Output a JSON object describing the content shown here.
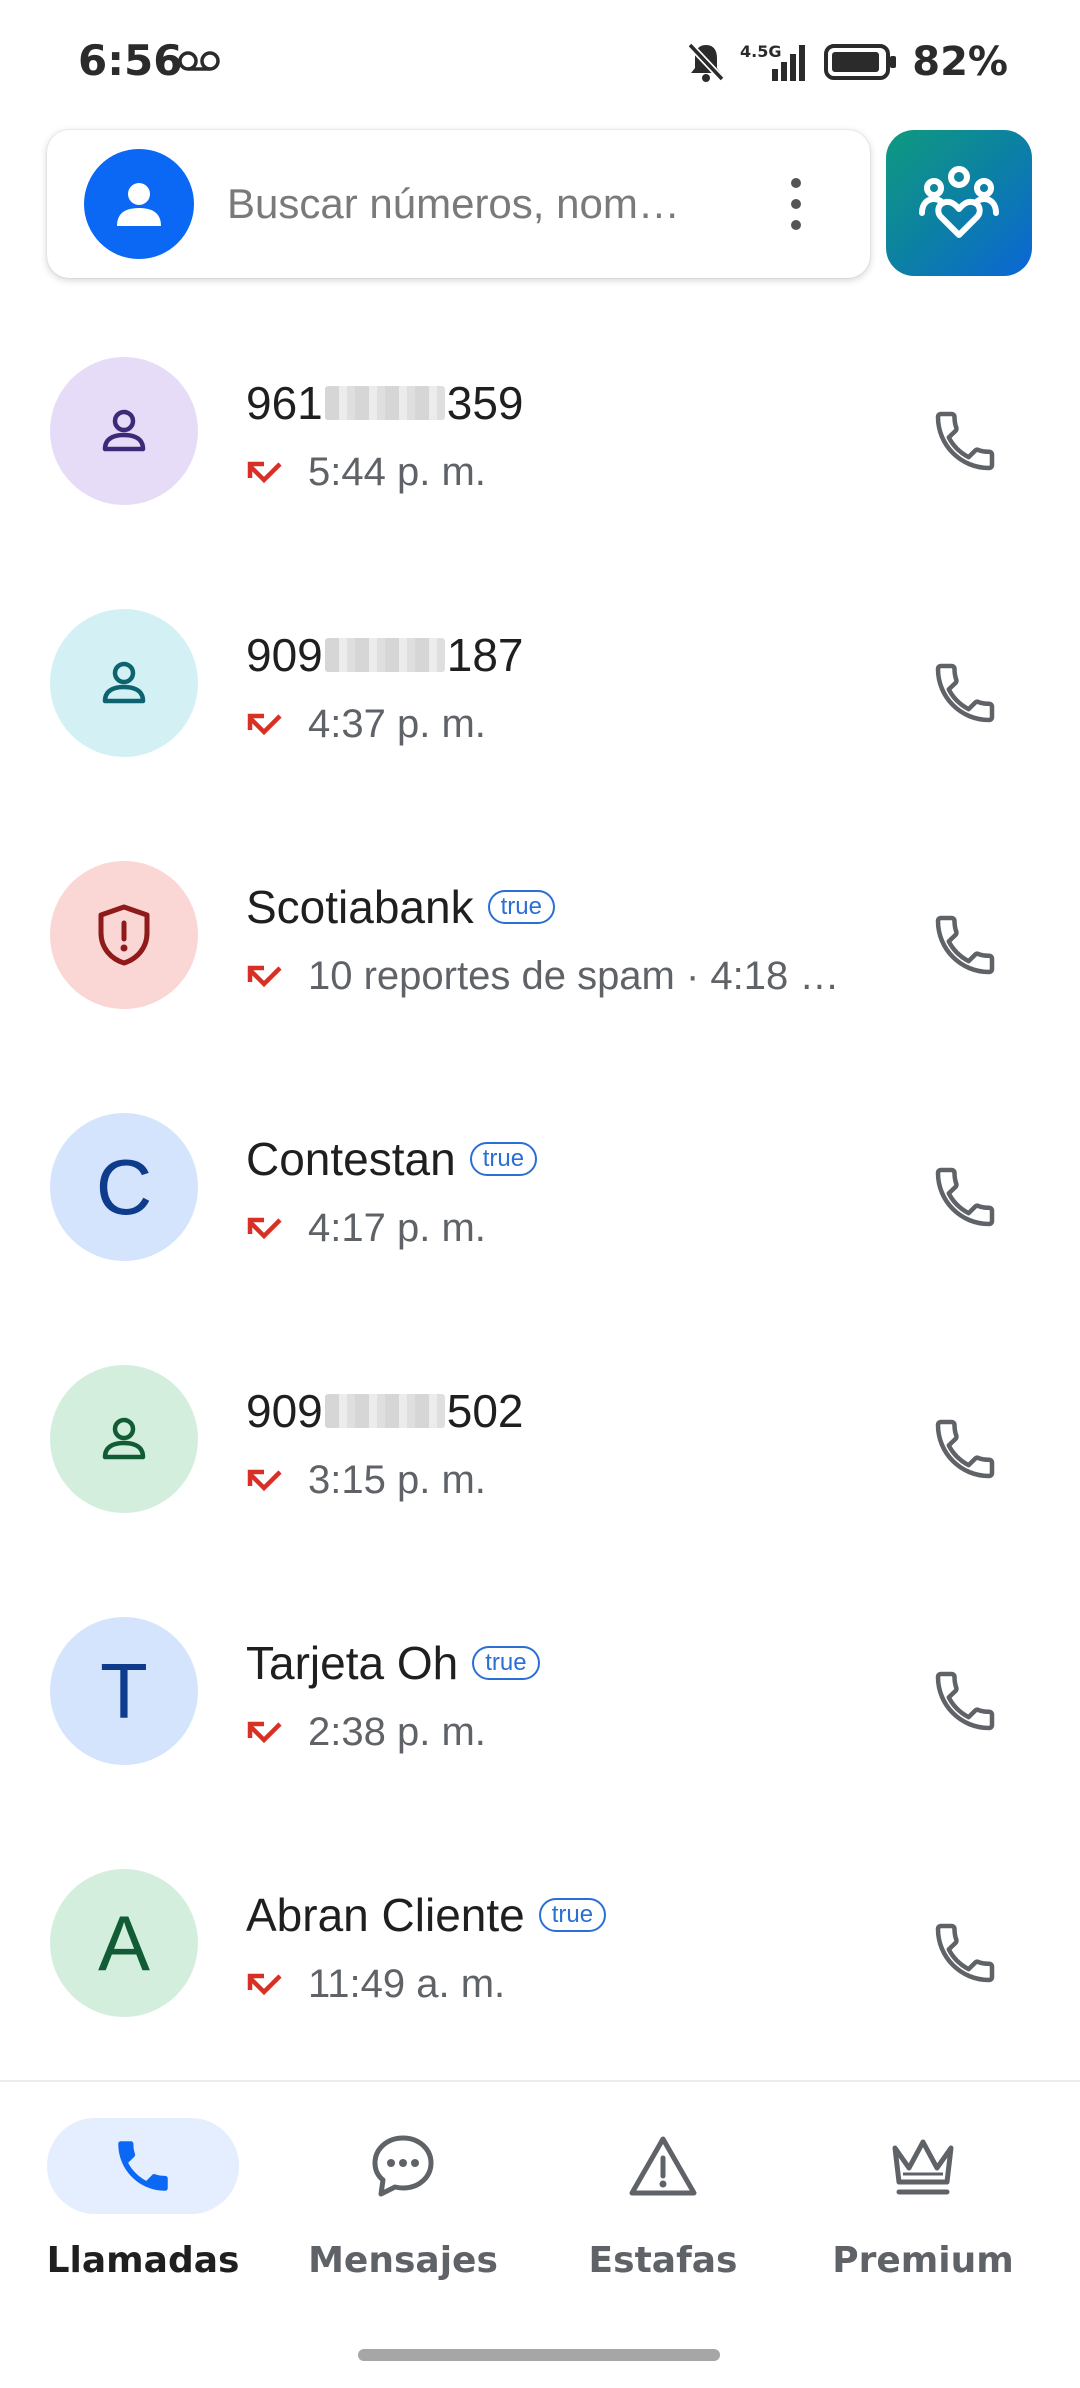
{
  "status_bar": {
    "time": "6:56",
    "network": "4.5G",
    "battery": "82%",
    "icons": [
      "voicemail-icon",
      "bell-off-icon",
      "signal-icon",
      "battery-icon"
    ]
  },
  "search": {
    "placeholder": "Buscar números, nom…"
  },
  "calls": [
    {
      "prefix": "961",
      "suffix": "359",
      "masked": true,
      "badge": "",
      "subtitle": "5:44 p. m.",
      "avatar": "person",
      "avatar_bg": "#e6dcf7",
      "avatar_fg": "#3b2a7a"
    },
    {
      "prefix": "909",
      "suffix": "187",
      "masked": true,
      "badge": "",
      "subtitle": "4:37 p. m.",
      "avatar": "person",
      "avatar_bg": "#d3f1f4",
      "avatar_fg": "#0d6470"
    },
    {
      "prefix": "Scotiabank",
      "suffix": "",
      "masked": false,
      "badge": "true",
      "subtitle": "10 reportes de spam · 4:18 …",
      "avatar": "shield",
      "avatar_bg": "#fad6d4",
      "avatar_fg": "#8e1a1a"
    },
    {
      "prefix": "Contestan",
      "suffix": "",
      "masked": false,
      "badge": "true",
      "subtitle": "4:17 p. m.",
      "avatar": "C",
      "avatar_bg": "#d4e4fc",
      "avatar_fg": "#0e3b8c"
    },
    {
      "prefix": "909",
      "suffix": "502",
      "masked": true,
      "badge": "",
      "subtitle": "3:15 p. m.",
      "avatar": "person",
      "avatar_bg": "#d4eede",
      "avatar_fg": "#125c35"
    },
    {
      "prefix": "Tarjeta Oh",
      "suffix": "",
      "masked": false,
      "badge": "true",
      "subtitle": "2:38 p. m.",
      "avatar": "T",
      "avatar_bg": "#d4e4fc",
      "avatar_fg": "#0e3b8c"
    },
    {
      "prefix": "Abran Cliente",
      "suffix": "",
      "masked": false,
      "badge": "true",
      "subtitle": "11:49 a. m.",
      "avatar": "A",
      "avatar_bg": "#d4eede",
      "avatar_fg": "#125c35"
    }
  ],
  "nav": [
    {
      "label": "Llamadas",
      "icon": "phone-icon",
      "active": true
    },
    {
      "label": "Mensajes",
      "icon": "chat-icon",
      "active": false
    },
    {
      "label": "Estafas",
      "icon": "warning-icon",
      "active": false
    },
    {
      "label": "Premium",
      "icon": "crown-icon",
      "active": false
    }
  ],
  "colors": {
    "accent": "#0b68f5",
    "missed_call": "#d93025",
    "secondary_text": "#5f6368"
  }
}
